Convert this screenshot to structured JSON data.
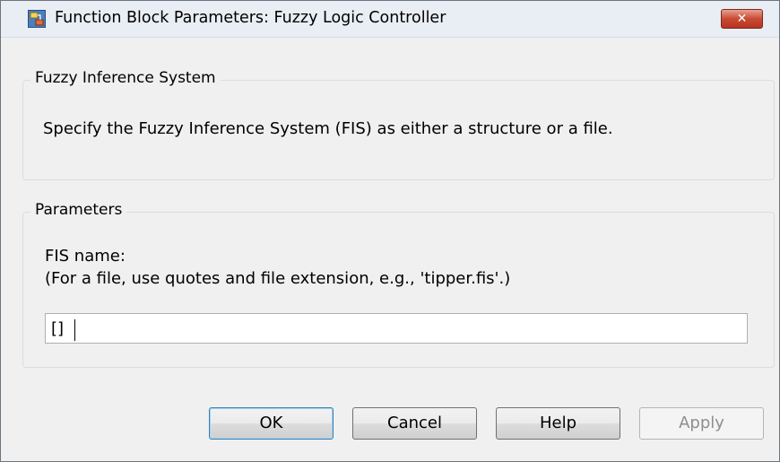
{
  "window": {
    "title": "Function Block Parameters: Fuzzy Logic Controller",
    "close_label": "✕"
  },
  "fis_group": {
    "legend": "Fuzzy Inference System",
    "description": "Specify the Fuzzy Inference System (FIS) as either a structure or a file."
  },
  "params_group": {
    "legend": "Parameters",
    "fis_name_label": "FIS name:",
    "fis_hint": "(For a file, use quotes and file extension, e.g., 'tipper.fis'.)",
    "fis_value": "[]"
  },
  "buttons": {
    "ok": "OK",
    "cancel": "Cancel",
    "help": "Help",
    "apply": "Apply"
  },
  "colors": {
    "accent": "#3c7fb1",
    "close": "#c94a35"
  }
}
